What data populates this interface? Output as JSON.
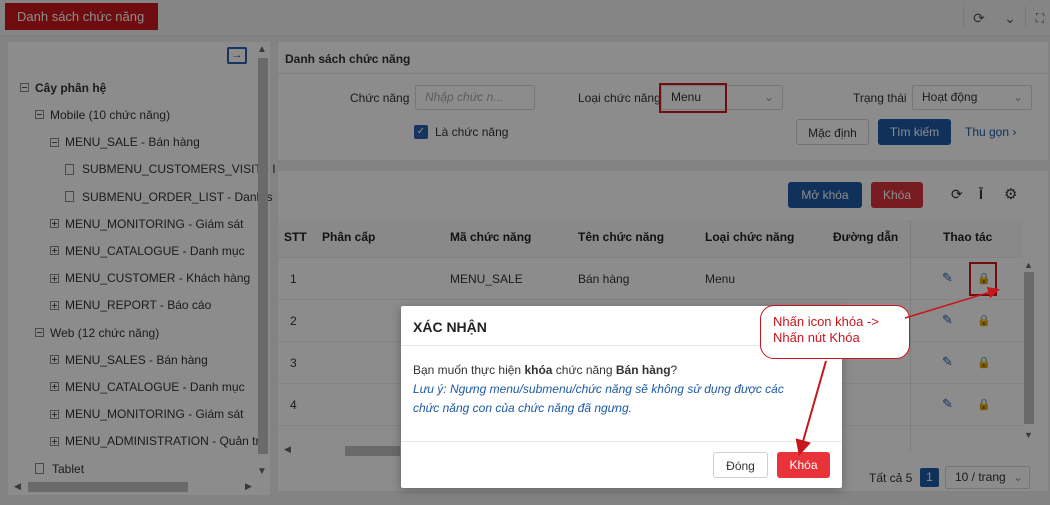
{
  "header": {
    "title": "Danh sách chức năng"
  },
  "tree": {
    "root_label": "Cây phân hệ",
    "items": [
      {
        "label": "Mobile (10 chức năng)",
        "level": 1,
        "icon": "minus"
      },
      {
        "label": "MENU_SALE - Bán hàng",
        "level": 2,
        "icon": "minus"
      },
      {
        "label": "SUBMENU_CUSTOMERS_VISIT - I",
        "level": 3,
        "icon": "doc"
      },
      {
        "label": "SUBMENU_ORDER_LIST - Danh s",
        "level": 3,
        "icon": "doc"
      },
      {
        "label": "MENU_MONITORING - Giám sát",
        "level": 2,
        "icon": "plus"
      },
      {
        "label": "MENU_CATALOGUE - Danh mục",
        "level": 2,
        "icon": "plus"
      },
      {
        "label": "MENU_CUSTOMER - Khách hàng",
        "level": 2,
        "icon": "plus"
      },
      {
        "label": "MENU_REPORT - Báo cáo",
        "level": 2,
        "icon": "plus"
      },
      {
        "label": "Web (12 chức năng)",
        "level": 1,
        "icon": "minus"
      },
      {
        "label": "MENU_SALES - Bán hàng",
        "level": 2,
        "icon": "plus"
      },
      {
        "label": "MENU_CATALOGUE - Danh mục",
        "level": 2,
        "icon": "plus"
      },
      {
        "label": "MENU_MONITORING - Giám sát",
        "level": 2,
        "icon": "plus"
      },
      {
        "label": "MENU_ADMINISTRATION - Quản trị",
        "level": 2,
        "icon": "plus"
      },
      {
        "label": "Tablet",
        "level": 1,
        "icon": "doc"
      }
    ]
  },
  "filter": {
    "section_title": "Danh sách chức năng",
    "func_label": "Chức năng",
    "func_placeholder": "Nhập chức n...",
    "type_label": "Loại chức năng",
    "type_value": "Menu",
    "status_label": "Trạng thái",
    "status_value": "Hoạt động",
    "is_function_label": "Là chức năng",
    "default_btn": "Mặc định",
    "search_btn": "Tìm kiếm",
    "collapse_link": "Thu gọn"
  },
  "actions": {
    "unlock_btn": "Mở khóa",
    "lock_btn": "Khóa"
  },
  "table": {
    "headers": [
      "STT",
      "Phân cấp",
      "Mã chức năng",
      "Tên chức năng",
      "Loại chức năng",
      "Đường dẫn",
      "Thao tác"
    ],
    "rows": [
      {
        "stt": "1",
        "code": "MENU_SALE",
        "name": "Bán hàng",
        "type": "Menu"
      },
      {
        "stt": "2",
        "code": "",
        "name": "",
        "type": ""
      },
      {
        "stt": "3",
        "code": "",
        "name": "",
        "type": ""
      },
      {
        "stt": "4",
        "code": "",
        "name": "",
        "type": ""
      }
    ]
  },
  "pagination": {
    "total": "Tất cả 5",
    "page": "1",
    "page_size": "10 / trang"
  },
  "modal": {
    "title": "XÁC NHẬN",
    "msg_pre": "Bạn muốn thực hiện ",
    "msg_bold1": "khóa",
    "msg_mid": " chức năng ",
    "msg_bold2": "Bán hàng",
    "msg_end": "?",
    "note": "Lưu ý: Ngưng menu/submenu/chức năng sẽ không sử dụng được các chức năng con của chức năng đã ngưng.",
    "close_btn": "Đóng",
    "lock_btn": "Khóa"
  },
  "callout": {
    "line1": "Nhấn icon khóa ->",
    "line2": "Nhấn nút Khóa"
  },
  "colors": {
    "brand_red": "#c8161d",
    "primary_blue": "#1d5aa5",
    "lock_red": "#e8333a"
  }
}
